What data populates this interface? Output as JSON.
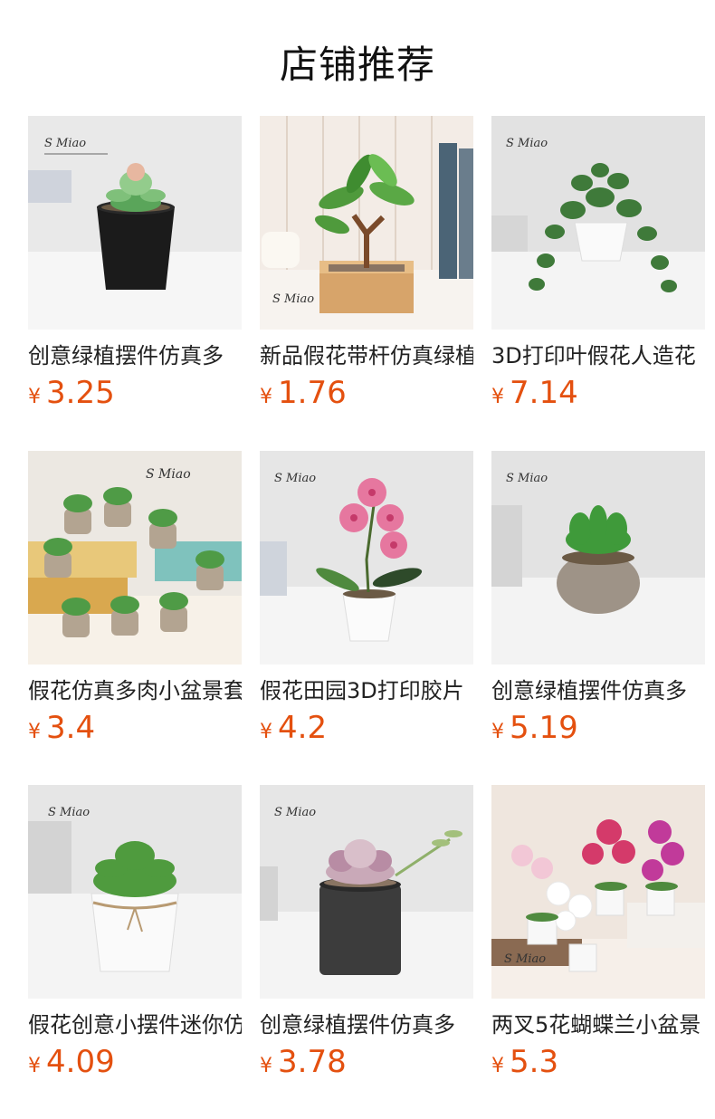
{
  "header": {
    "title": "店铺推荐"
  },
  "products": [
    {
      "name": "创意绿植摆件仿真多",
      "currency": "¥",
      "price": "3.25",
      "image_icon": "succulent-black-pot-image"
    },
    {
      "name": "新品假花带杆仿真绿植",
      "currency": "¥",
      "price": "1.76",
      "image_icon": "tree-bamboo-pot-image"
    },
    {
      "name": "3D打印叶假花人造花",
      "currency": "¥",
      "price": "7.14",
      "image_icon": "trailing-plant-white-pot-image"
    },
    {
      "name": "假花仿真多肉小盆景套",
      "currency": "¥",
      "price": "3.4",
      "image_icon": "succulent-set-image"
    },
    {
      "name": "假花田园3D打印胶片",
      "currency": "¥",
      "price": "4.2",
      "image_icon": "pink-orchid-image"
    },
    {
      "name": "创意绿植摆件仿真多",
      "currency": "¥",
      "price": "5.19",
      "image_icon": "succulent-stone-pot-image"
    },
    {
      "name": "假花创意小摆件迷你仿",
      "currency": "¥",
      "price": "4.09",
      "image_icon": "succulent-twine-pot-image"
    },
    {
      "name": "创意绿植摆件仿真多",
      "currency": "¥",
      "price": "3.78",
      "image_icon": "pink-succulent-image"
    },
    {
      "name": "两叉5花蝴蝶兰小盆景",
      "currency": "¥",
      "price": "5.3",
      "image_icon": "butterfly-orchid-image"
    }
  ],
  "colors": {
    "price": "#e4500f",
    "title": "#111111"
  }
}
